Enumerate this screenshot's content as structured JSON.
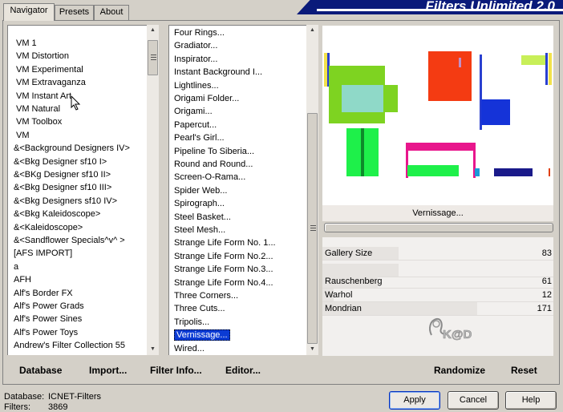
{
  "brand": {
    "title": "Filters Unlimited 2.0"
  },
  "tabs": [
    {
      "label": "Navigator",
      "active": true
    },
    {
      "label": "Presets",
      "active": false
    },
    {
      "label": "About",
      "active": false
    }
  ],
  "categories": [
    "VM 1",
    "VM Distortion",
    "VM Experimental",
    "VM Extravaganza",
    "VM Instant Art",
    "VM Natural",
    "VM Toolbox",
    "VM",
    "&<Background Designers IV>",
    "&<Bkg Designer sf10 I>",
    "&<BKg Designer sf10 II>",
    "&<Bkg Designer sf10 III>",
    "&<Bkg Designers sf10 IV>",
    "&<Bkg Kaleidoscope>",
    "&<Kaleidoscope>",
    "&<Sandflower Specials^v^ >",
    "[AFS IMPORT]",
    "a",
    "AFH",
    "Alf's Border FX",
    "Alf's Power Grads",
    "Alf's Power Sines",
    "Alf's Power Toys",
    "Andrew's Filter Collection 55"
  ],
  "filters": [
    "Four Rings...",
    "Gradiator...",
    "Inspirator...",
    "Instant Background I...",
    "Lightlines...",
    "Origami Folder...",
    "Origami...",
    "Papercut...",
    "Pearl's Girl...",
    "Pipeline To Siberia...",
    "Round and Round...",
    "Screen-O-Rama...",
    "Spider Web...",
    "Spirograph...",
    "Steel Basket...",
    "Steel Mesh...",
    "Strange Life Form No. 1...",
    "Strange Life Form No.2...",
    "Strange Life Form No.3...",
    "Strange Life Form No.4...",
    "Three Corners...",
    "Three Cuts...",
    "Tripolis...",
    "Vernissage...",
    "Wired..."
  ],
  "selected_filter_index": 23,
  "selected_filter_name": "Vernissage...",
  "sliders": [
    {
      "label": "Gallery Size",
      "value": "83",
      "level": 0.33
    },
    {
      "label": "",
      "value": "",
      "level": 0.33
    },
    {
      "label": "Rauschenberg",
      "value": "61",
      "level": 0.24
    },
    {
      "label": "Warhol",
      "value": "12",
      "level": 0.05
    },
    {
      "label": "Mondrian",
      "value": "171",
      "level": 0.67
    }
  ],
  "buttons": {
    "database": "Database",
    "import": "Import...",
    "filter_info": "Filter Info...",
    "editor": "Editor...",
    "randomize": "Randomize",
    "reset": "Reset",
    "apply": "Apply",
    "cancel": "Cancel",
    "help": "Help"
  },
  "status": {
    "database_label": "Database:",
    "database_value": "ICNET-Filters",
    "filters_label": "Filters:",
    "filters_value": "3869"
  },
  "watermark_text": "K@D",
  "colors": {
    "selection": "#0b3bd4",
    "brand_bar": "#0a1a7a",
    "preview_green": "#7ed321",
    "preview_red": "#f43b12",
    "preview_blue": "#1533d8",
    "preview_magenta": "#e8168c",
    "preview_lime": "#1ef04a"
  }
}
